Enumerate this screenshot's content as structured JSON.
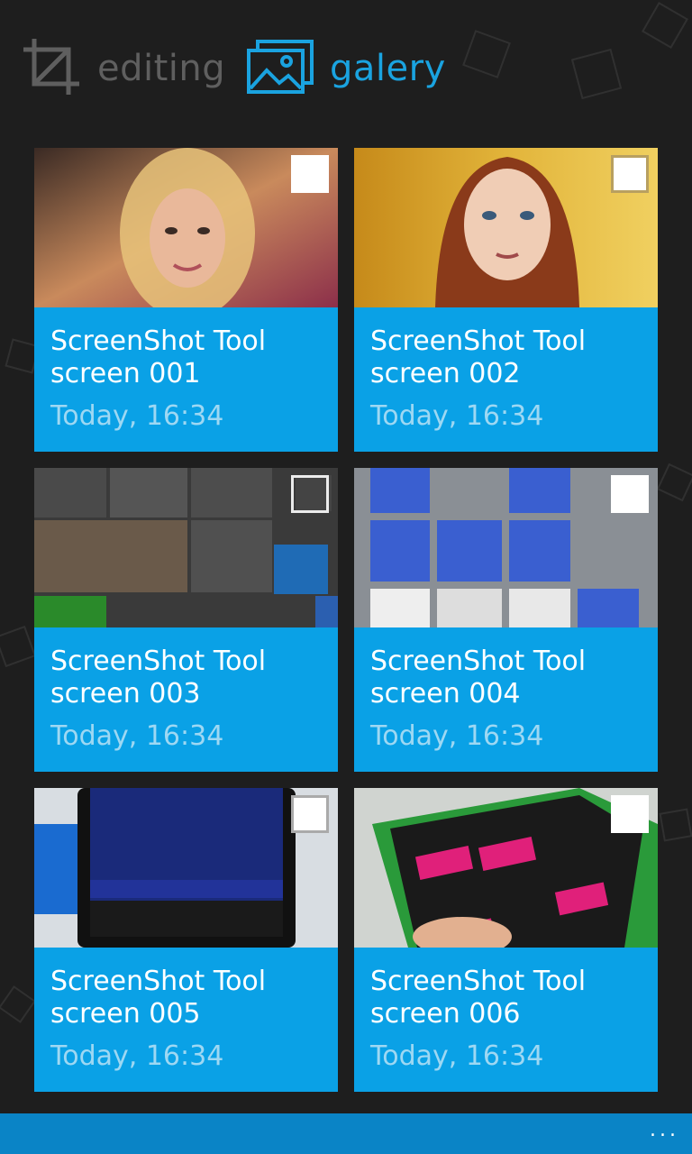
{
  "header": {
    "tabs": [
      {
        "label": "editing",
        "icon": "crop-icon",
        "color": "#5f5f5f"
      },
      {
        "label": "galery",
        "icon": "gallery-icon",
        "color": "#1aa3e0"
      }
    ]
  },
  "gallery": {
    "items": [
      {
        "title": "ScreenShot Tool screen 001",
        "date": "Today, 16:34"
      },
      {
        "title": "ScreenShot Tool screen 002",
        "date": "Today, 16:34"
      },
      {
        "title": "ScreenShot Tool screen 003",
        "date": "Today, 16:34"
      },
      {
        "title": "ScreenShot Tool screen 004",
        "date": "Today, 16:34"
      },
      {
        "title": "ScreenShot Tool screen 005",
        "date": "Today, 16:34"
      },
      {
        "title": "ScreenShot Tool screen 006",
        "date": "Today, 16:34"
      }
    ]
  },
  "appbar": {
    "more_label": "..."
  },
  "colors": {
    "accent": "#0aa1e6",
    "background": "#1e1e1e",
    "appbar": "#0a84c6"
  }
}
